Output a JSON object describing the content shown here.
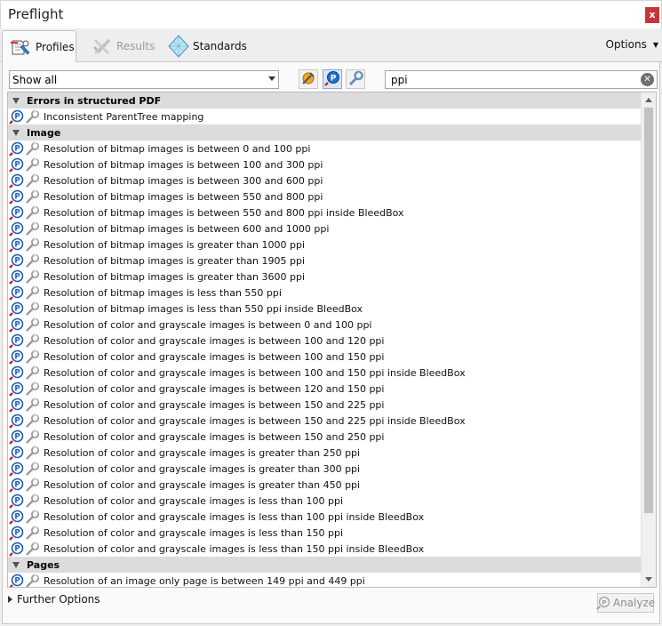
{
  "window": {
    "title": "Preflight",
    "close_glyph": "x"
  },
  "tabs": [
    {
      "label": "Profiles",
      "icon": "profiles-icon",
      "active": true
    },
    {
      "label": "Results",
      "icon": "results-icon",
      "active": false
    },
    {
      "label": "Standards",
      "icon": "standards-icon",
      "active": false
    }
  ],
  "options": {
    "label": "Options"
  },
  "filter": {
    "selected": "Show all"
  },
  "toolbar": {
    "buttons": [
      "fixups-icon",
      "checks-icon",
      "wrench-icon"
    ]
  },
  "search": {
    "value": "ppi"
  },
  "groups": [
    {
      "name": "Errors in structured PDF",
      "items": [
        "Inconsistent ParentTree mapping"
      ]
    },
    {
      "name": "Image",
      "items": [
        "Resolution of bitmap images is between 0 and 100 ppi",
        "Resolution of bitmap images is between 100 and 300 ppi",
        "Resolution of bitmap images is between 300 and 600 ppi",
        "Resolution of bitmap images is between 550 and 800 ppi",
        "Resolution of bitmap images is between 550 and 800 ppi inside BleedBox",
        "Resolution of bitmap images is between 600 and 1000 ppi",
        "Resolution of bitmap images is greater than 1000 ppi",
        "Resolution of bitmap images is greater than 1905 ppi",
        "Resolution of bitmap images is greater than 3600 ppi",
        "Resolution of bitmap images is less than 550 ppi",
        "Resolution of bitmap images is less than 550 ppi inside BleedBox",
        "Resolution of color and grayscale images is between 0 and 100 ppi",
        "Resolution of color and grayscale images is between 100 and 120 ppi",
        "Resolution of color and grayscale images is between 100 and 150 ppi",
        "Resolution of color and grayscale images is between 100 and 150 ppi inside BleedBox",
        "Resolution of color and grayscale images is between 120 and 150 ppi",
        "Resolution of color and grayscale images is between 150 and 225 ppi",
        "Resolution of color and grayscale images is between 150 and 225 ppi inside BleedBox",
        "Resolution of color and grayscale images is between 150 and 250 ppi",
        "Resolution of color and grayscale images is greater than 250 ppi",
        "Resolution of color and grayscale images is greater than 300 ppi",
        "Resolution of color and grayscale images is greater than 450 ppi",
        "Resolution of color and grayscale images is less than 100 ppi",
        "Resolution of color and grayscale images is less than 100 ppi inside BleedBox",
        "Resolution of color and grayscale images is less than 150 ppi",
        "Resolution of color and grayscale images is less than 150 ppi inside BleedBox"
      ]
    },
    {
      "name": "Pages",
      "items": [
        "Resolution of an image only page is between 149 ppi and 449 ppi"
      ]
    }
  ],
  "footer": {
    "further_options": "Further Options",
    "analyze": "Analyze"
  },
  "colors": {
    "accent": "#1a5fb4",
    "close": "#c7353b",
    "group_bg": "#dcdcdc"
  }
}
